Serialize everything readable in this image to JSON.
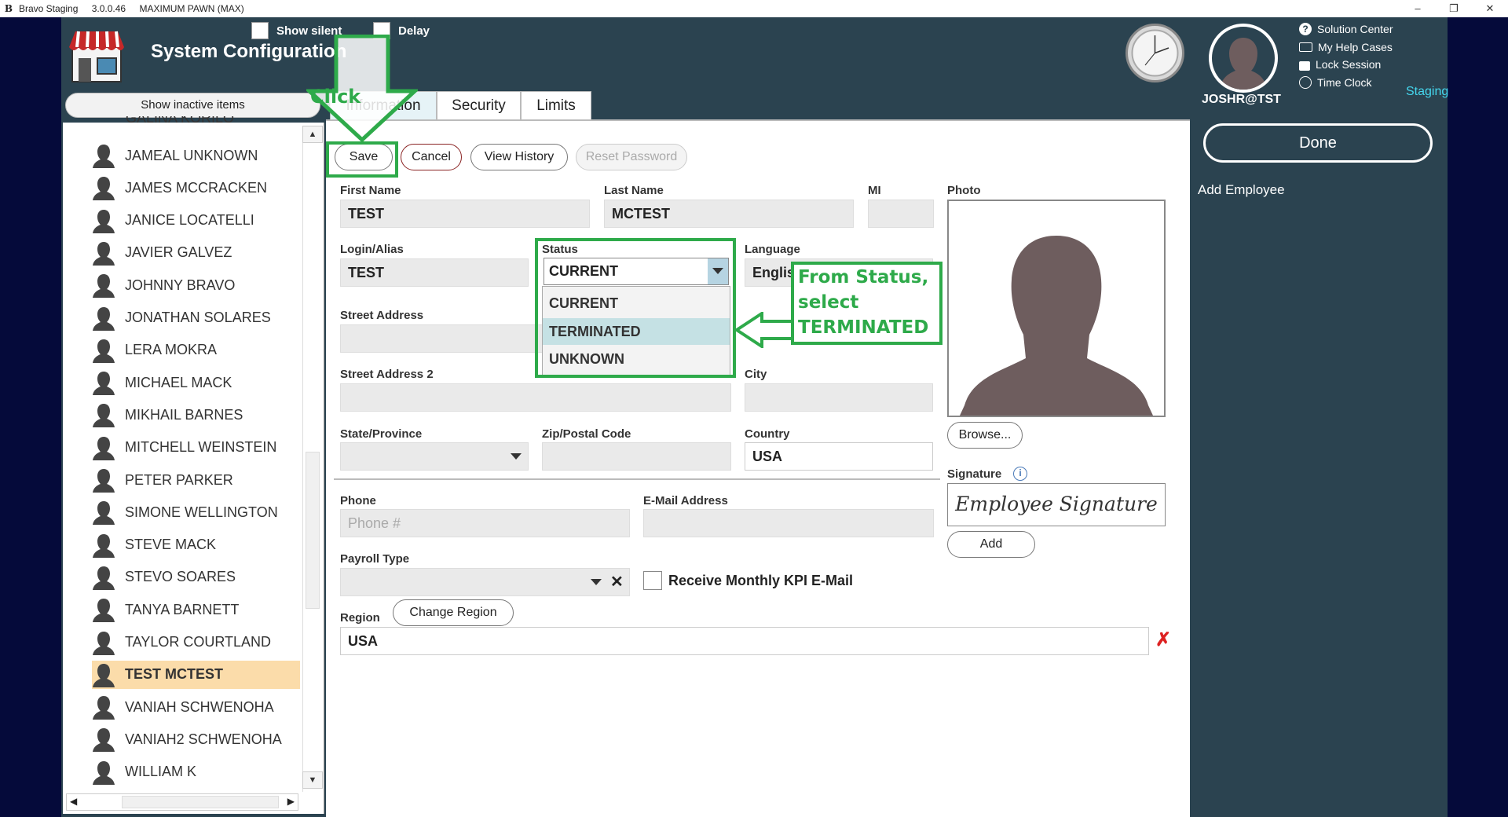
{
  "window": {
    "app_letter": "B",
    "app_name": "Bravo Staging",
    "version": "3.0.0.46",
    "store": "MAXIMUM PAWN (MAX)",
    "minimize": "–",
    "restore": "❐",
    "close": "✕"
  },
  "header": {
    "title": "System Configuration",
    "show_silent": "Show silent",
    "delay": "Delay"
  },
  "sidebar": {
    "show_inactive": "Show inactive items",
    "partial_top": "GALINA KORILO",
    "employees": [
      "JAMEAL UNKNOWN",
      "JAMES MCCRACKEN",
      "JANICE LOCATELLI",
      "JAVIER GALVEZ",
      "JOHNNY BRAVO",
      "JONATHAN SOLARES",
      "LERA MOKRA",
      "MICHAEL MACK",
      "MIKHAIL BARNES",
      "MITCHELL WEINSTEIN",
      "PETER PARKER",
      "SIMONE WELLINGTON",
      "STEVE MACK",
      "STEVO SOARES",
      "TANYA BARNETT",
      "TAYLOR COURTLAND",
      "TEST MCTEST",
      "VANIAH SCHWENOHA",
      "VANIAH2 SCHWENOHA",
      "WILLIAM K"
    ],
    "selected": "TEST MCTEST"
  },
  "tabs": [
    "Information",
    "Security",
    "Limits"
  ],
  "actions": {
    "save": "Save",
    "cancel": "Cancel",
    "view_history": "View History",
    "reset_password": "Reset Password"
  },
  "form": {
    "first_name_label": "First Name",
    "first_name": "TEST",
    "last_name_label": "Last Name",
    "last_name": "MCTEST",
    "mi_label": "MI",
    "mi": "",
    "login_label": "Login/Alias",
    "login": "TEST",
    "status_label": "Status",
    "status": "CURRENT",
    "status_options": [
      "CURRENT",
      "TERMINATED",
      "UNKNOWN"
    ],
    "language_label": "Language",
    "language": "Englis",
    "street_label": "Street Address",
    "street": "",
    "street2_label": "Street Address 2",
    "street2": "",
    "city_label": "City",
    "city": "",
    "state_label": "State/Province",
    "state": "",
    "zip_label": "Zip/Postal Code",
    "zip": "",
    "country_label": "Country",
    "country": "USA",
    "phone_label": "Phone",
    "phone_placeholder": "Phone #",
    "email_label": "E-Mail Address",
    "email": "",
    "payroll_label": "Payroll Type",
    "payroll": "",
    "kpi_label": "Receive Monthly KPI E-Mail",
    "region_label": "Region",
    "change_region": "Change Region",
    "region": "USA"
  },
  "photo": {
    "label": "Photo",
    "browse": "Browse...",
    "signature_label": "Signature",
    "signature_text": "Employee Signature",
    "add": "Add"
  },
  "right": {
    "user": "JOSHR@TST",
    "links": [
      "Solution Center",
      "My Help Cases",
      "Lock Session",
      "Time Clock"
    ],
    "env": "Staging",
    "done": "Done",
    "add_employee": "Add Employee"
  },
  "annotations": {
    "click": "Click",
    "callout_lines": [
      "From Status,",
      "select",
      "TERMINATED"
    ]
  },
  "colors": {
    "accent_green": "#2eaa4a",
    "panel_dark": "#2b4350",
    "selected_row": "#fbdcaa",
    "option_highlight": "#c5e1e4",
    "staging_cyan": "#45d7ee"
  }
}
